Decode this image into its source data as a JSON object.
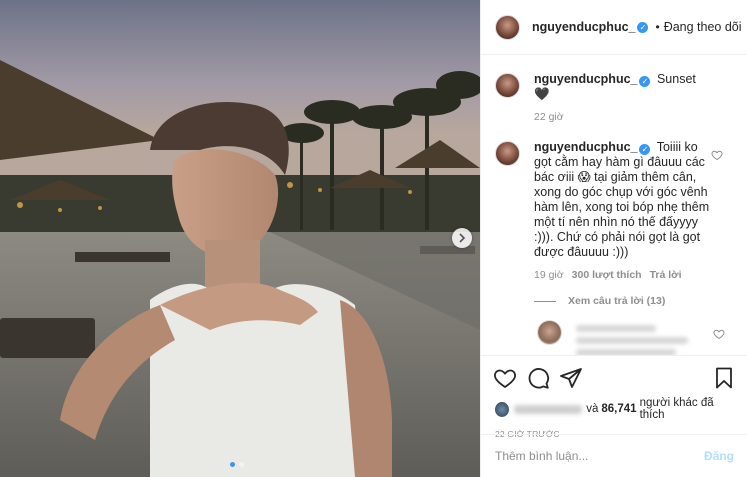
{
  "post": {
    "image_alt": "",
    "carousel_dot_count": 2,
    "carousel_active_index": 1
  },
  "header": {
    "username": "nguyenducphuc_",
    "separator": "•",
    "follow_status": "Đang theo dõi"
  },
  "caption": {
    "username": "nguyenducphuc_",
    "text": "Sunset 🖤",
    "time": "22 giờ"
  },
  "comment": {
    "username": "nguyenducphuc_",
    "text": "Toiiii ko gọt cằm hay hàm gì đâuuu các bác ơiii 😱 tại giảm thêm cân, xong do góc chụp với góc vênh hàm lên, xong toi bóp nhẹ thêm một tí nên nhìn nó thế đấyyyy :))). Chứ có phải nói gọt là gọt được đâuuuu :)))",
    "time": "19 giờ",
    "likes": "300 lượt thích",
    "reply_label": "Trả lời",
    "view_replies": "Xem câu trả lời (13)"
  },
  "likes_summary": {
    "and": "và",
    "count": "86,741",
    "rest": "người khác đã thích"
  },
  "timestamp": "22 GIỜ TRƯỚC",
  "comment_box": {
    "placeholder": "Thêm bình luận...",
    "post_label": "Đăng"
  },
  "colors": {
    "verified": "#3897f0",
    "post_disabled": "#b2dffc",
    "muted": "#8e8e8e",
    "divider": "#efefef"
  },
  "icons": [
    "heart-icon",
    "comment-icon",
    "share-icon",
    "bookmark-icon",
    "verified-badge-icon",
    "chevron-right-icon"
  ]
}
